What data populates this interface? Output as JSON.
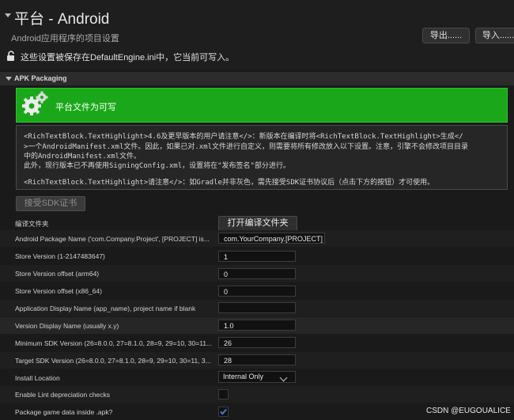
{
  "header": {
    "title": "平台 - Android",
    "subtitle": "Android应用程序的项目设置",
    "export_label": "导出......",
    "import_label": "导入......",
    "writable_notice": "这些设置被保存在DefaultEngine.ini中，它当前可写入。"
  },
  "section": {
    "name": "APK Packaging"
  },
  "banner": {
    "text": "平台文件为可写"
  },
  "note": {
    "lines": [
      "<RichTextBlock.TextHighlight>4.6及更早版本的用户请注意</>：新版本在编译时将<RichTextBlock.TextHighlight>生成</",
      ">一个AndroidManifest.xml文件。因此，如果已对.xml文件进行自定义，则需要将所有修改放入以下设置。注意，引擎不会修改项目目录",
      "中的AndroidManifest.xml文件。",
      "此外，现行版本已不再使用SigningConfig.xml，设置将在\"发布签名\"部分进行。",
      "",
      "<RichTextBlock.TextHighlight>请注意</>：如Gradle并非灰色，需先接受SDK证书协议后（点击下方的按钮）才可使用。"
    ]
  },
  "accept_sdk_label": "接受SDK证书",
  "settings": {
    "build_folder_label": "编译文件夹",
    "open_build_folder_label": "打开编译文件夹",
    "package_name_label": "Android Package Name ('com.Company.Project', [PROJECT] is...",
    "package_name_value": "com.YourCompany.[PROJECT]",
    "store_version_label": "Store Version (1-2147483647)",
    "store_version_value": "1",
    "store_offset_arm64_label": "Store Version offset (arm64)",
    "store_offset_arm64_value": "0",
    "store_offset_x86_label": "Store Version offset (x86_64)",
    "store_offset_x86_value": "0",
    "app_display_name_label": "Application Display Name (app_name), project name if blank",
    "app_display_name_value": "",
    "version_display_label": "Version Display Name (usually x.y)",
    "version_display_value": "1.0",
    "min_sdk_label": "Minimum SDK Version (26=8.0.0, 27=8.1.0, 28=9, 29=10, 30=11...",
    "min_sdk_value": "26",
    "target_sdk_label": "Target SDK Version (26=8.0.0, 27=8.1.0, 28=9, 29=10, 30=11, 3...",
    "target_sdk_value": "28",
    "install_location_label": "Install Location",
    "install_location_value": "Internal Only",
    "lint_label": "Enable Lint depreciation checks",
    "lint_checked": false,
    "package_game_data_label": "Package game data inside .apk?",
    "package_game_data_checked": true
  },
  "watermark": "CSDN @EUGOUALICE",
  "colors": {
    "banner_green": "#1aa81a",
    "checkbox_blue": "#3d7be0"
  }
}
